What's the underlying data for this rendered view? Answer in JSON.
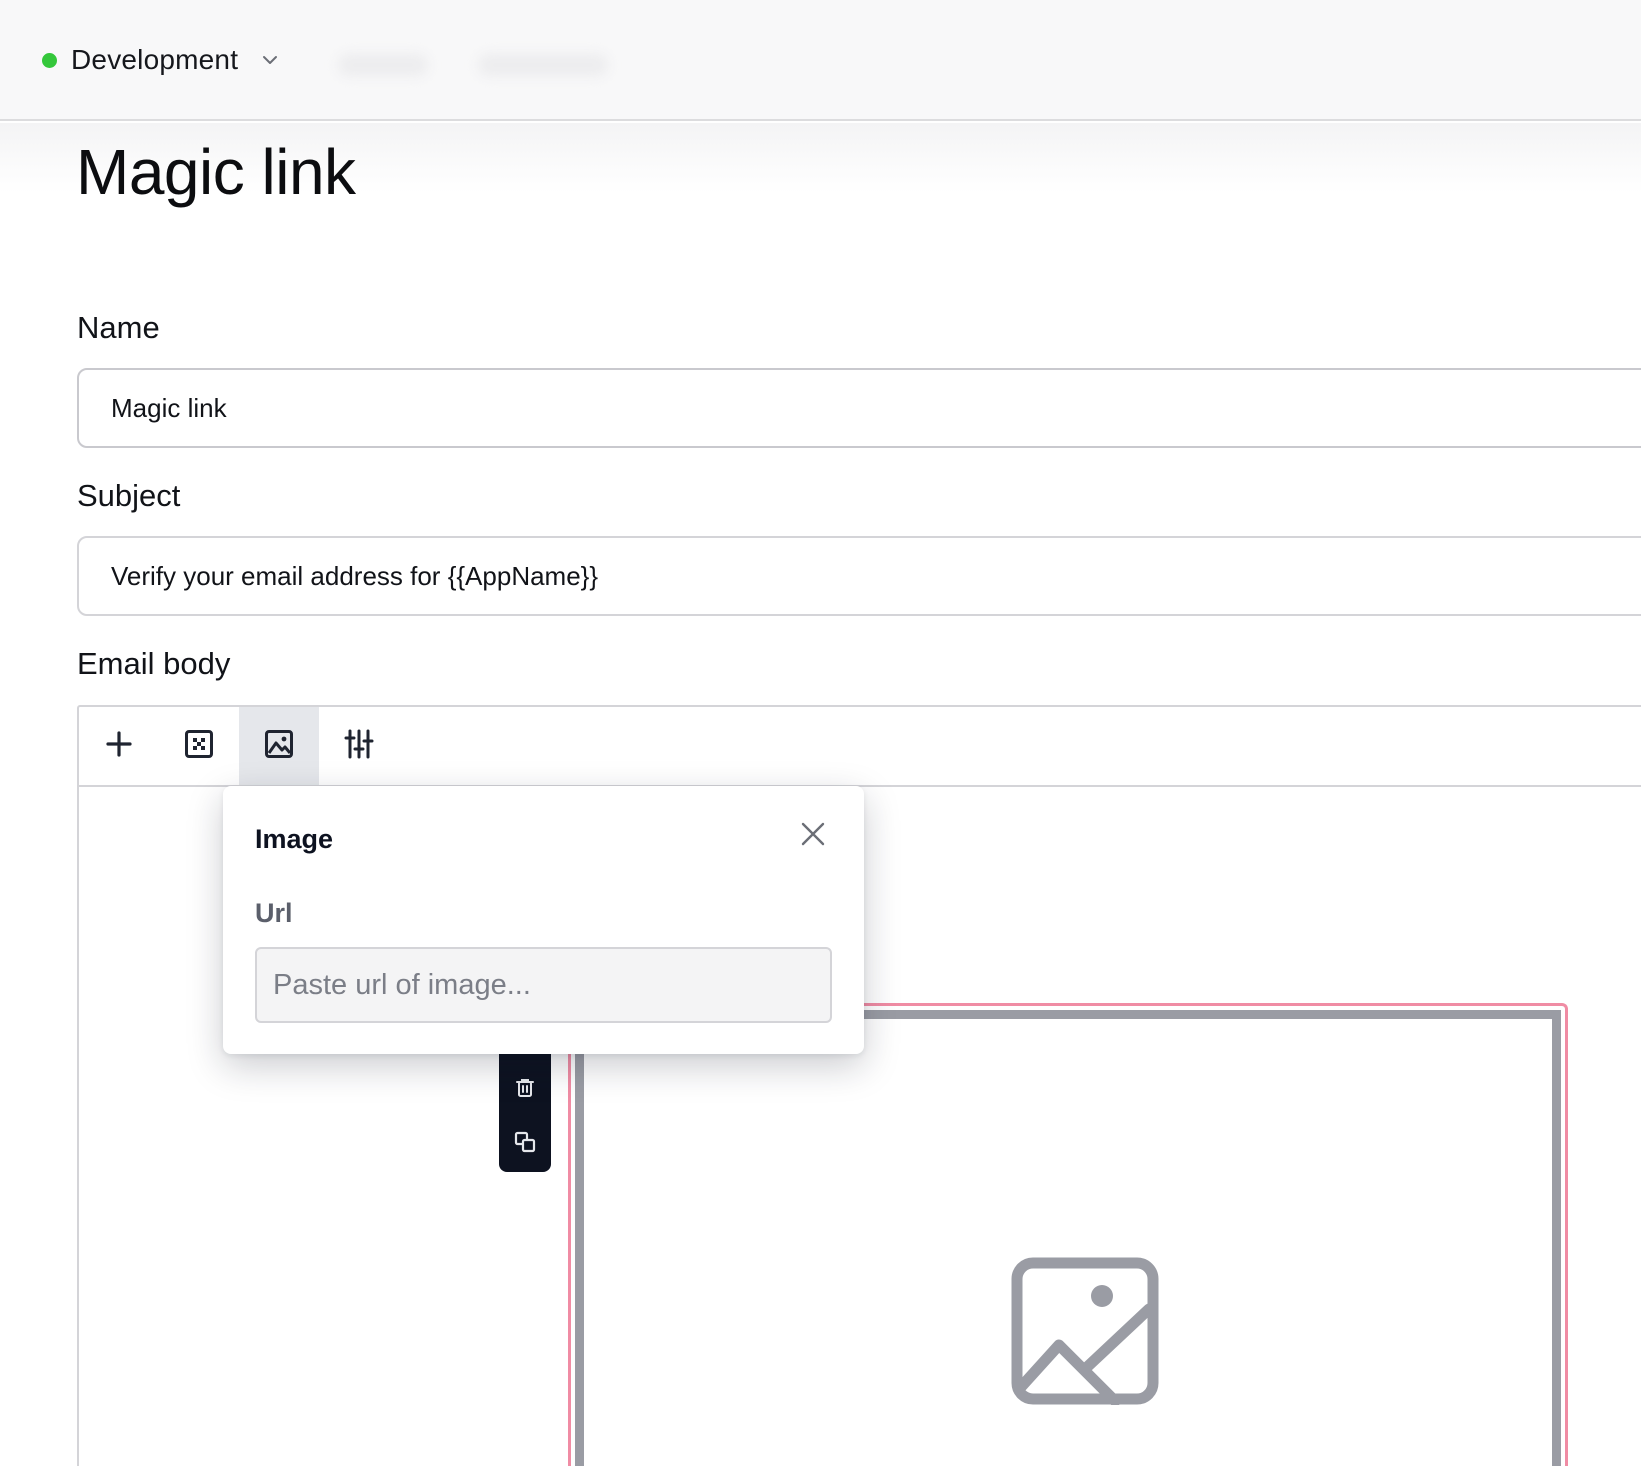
{
  "topbar": {
    "environment": {
      "label": "Development",
      "status_color": "#34c73b"
    }
  },
  "page": {
    "title": "Magic link"
  },
  "form": {
    "name": {
      "label": "Name",
      "value": "Magic link"
    },
    "subject": {
      "label": "Subject",
      "value": "Verify your email address for {{AppName}}"
    },
    "email_body": {
      "label": "Email body"
    }
  },
  "toolbar": {
    "items": [
      {
        "icon": "plus-icon",
        "active": false
      },
      {
        "icon": "layout-icon",
        "active": false
      },
      {
        "icon": "image-icon",
        "active": true
      },
      {
        "icon": "sliders-icon",
        "active": false
      }
    ]
  },
  "block_actions": [
    "trash-icon",
    "duplicate-icon"
  ],
  "image_popover": {
    "title": "Image",
    "url_label": "Url",
    "url_placeholder": "Paste url of image...",
    "url_value": ""
  },
  "colors": {
    "accent_selection": "#f08ca4",
    "placeholder_gray": "#9a9ca4",
    "dark_panel": "#0d1220"
  }
}
